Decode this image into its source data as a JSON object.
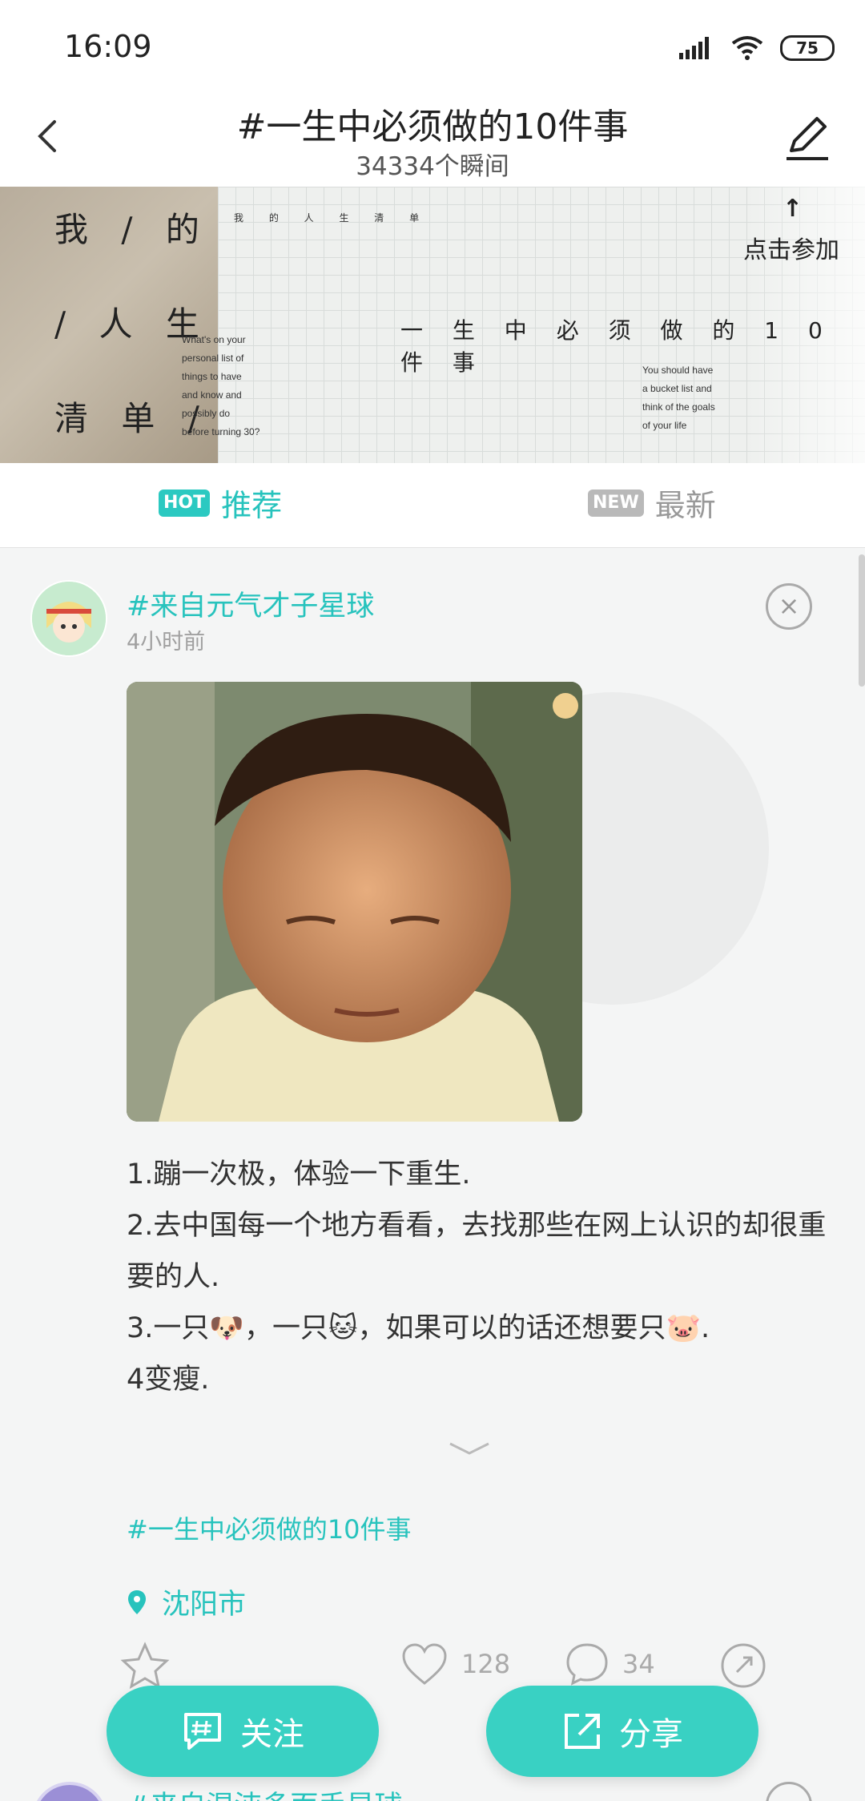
{
  "status_bar": {
    "time": "16:09",
    "battery": "75"
  },
  "nav": {
    "title": "#一生中必须做的10件事",
    "subtitle": "34334个瞬间"
  },
  "banner": {
    "left_lines": [
      "我 / 的",
      "/ 人 生",
      "清 单 /"
    ],
    "top_text": "我 的 人 生 清 单",
    "left_small": [
      "What's on your",
      "personal list of",
      "things to have",
      "and know and",
      "possibly do",
      "before turning 30?"
    ],
    "main_text": "一 生 中 必 须 做 的 1 0 件 事",
    "right_small": [
      "You should have",
      "a bucket list and",
      "think of the goals",
      "of your life"
    ],
    "join_label": "点击参加"
  },
  "tabs": [
    {
      "badge": "HOT",
      "label": "推荐"
    },
    {
      "badge": "NEW",
      "label": "最新"
    }
  ],
  "post": {
    "source": "#来自元气才子星球",
    "time": "4小时前",
    "lines": [
      "1.蹦一次极，体验一下重生.",
      "2.去中国每一个地方看看，去找那些在网上认识的却很重要的人.",
      "3.一只🐶，一只🐱，如果可以的话还想要只🐷.",
      "4变瘦."
    ],
    "tag": "#一生中必须做的10件事",
    "location": "沈阳市",
    "likes": "128",
    "comments": "34"
  },
  "next_post": {
    "source": "#来自混沌多面手星球"
  },
  "buttons": {
    "follow": "关注",
    "share": "分享"
  },
  "colors": {
    "accent": "#27c3bd",
    "fab": "#39d1c3"
  }
}
